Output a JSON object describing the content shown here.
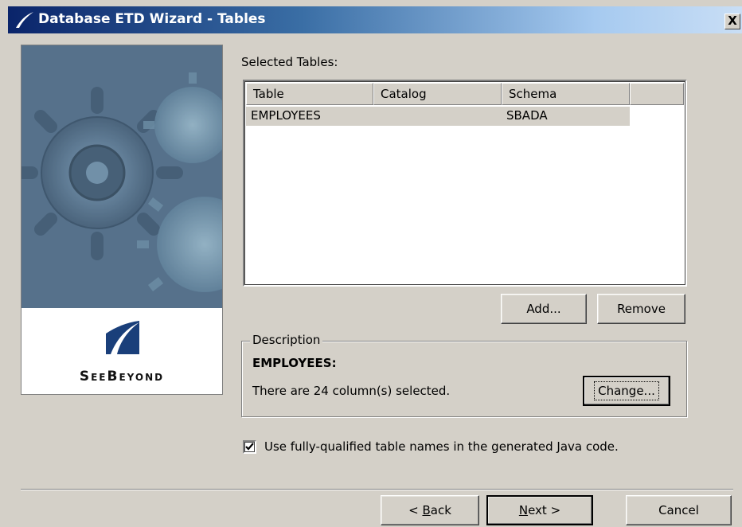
{
  "window": {
    "title": "Database ETD Wizard - Tables",
    "close_glyph": "X"
  },
  "branding": {
    "logo_text": "SeeBeyond",
    "logo_icon": "seebeyond-logo-icon",
    "photo": "gears-photo"
  },
  "tables": {
    "label": "Selected Tables:",
    "columns": [
      "Table",
      "Catalog",
      "Schema",
      ""
    ],
    "rows": [
      {
        "table": "EMPLOYEES",
        "catalog": "",
        "schema": "SBADA"
      }
    ],
    "add_label": "Add...",
    "remove_label": "Remove"
  },
  "description": {
    "legend": "Description",
    "table_name": "EMPLOYEES:",
    "summary": "There are 24 column(s) selected.",
    "change_label": "Change..."
  },
  "options": {
    "fully_qualified_label": "Use fully-qualified table names in the generated Java code.",
    "fully_qualified_checked": true
  },
  "footer": {
    "back_lt": "< ",
    "back_mnemonic": "B",
    "back_rest": "ack",
    "next_mnemonic": "N",
    "next_rest": "ext >",
    "cancel_label": "Cancel"
  },
  "colors": {
    "titlebar_start": "#0a246a",
    "titlebar_end": "#c9def5",
    "dialog_bg": "#d4d0c8",
    "logo_blue": "#1a3f7a"
  }
}
